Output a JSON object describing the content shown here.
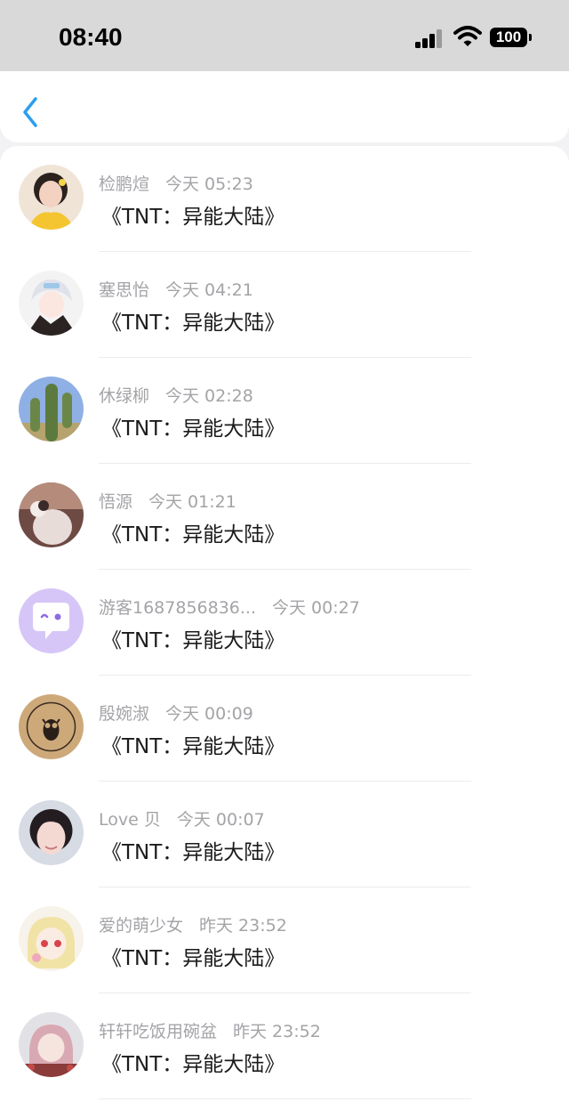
{
  "status_bar": {
    "time": "08:40",
    "battery": "100"
  },
  "nav": {
    "back_icon": "chevron-left-icon"
  },
  "colors": {
    "accent": "#2b9ef0",
    "meta_text": "#a4a4a8"
  },
  "items": [
    {
      "name": "检鹏煊",
      "time": "今天 05:23",
      "title": "《TNT：异能大陆》"
    },
    {
      "name": "塞思怡",
      "time": "今天 04:21",
      "title": "《TNT：异能大陆》"
    },
    {
      "name": "休绿柳",
      "time": "今天 02:28",
      "title": "《TNT：异能大陆》"
    },
    {
      "name": "悟源",
      "time": "今天 01:21",
      "title": "《TNT：异能大陆》"
    },
    {
      "name": "游客1687856836...",
      "time": "今天 00:27",
      "title": "《TNT：异能大陆》"
    },
    {
      "name": "殷婉淑",
      "time": "今天 00:09",
      "title": "《TNT：异能大陆》"
    },
    {
      "name": "Love 贝",
      "time": "今天 00:07",
      "title": "《TNT：异能大陆》"
    },
    {
      "name": "爱的萌少女",
      "time": "昨天 23:52",
      "title": "《TNT：异能大陆》"
    },
    {
      "name": "轩轩吃饭用碗盆",
      "time": "昨天 23:52",
      "title": "《TNT：异能大陆》"
    }
  ]
}
